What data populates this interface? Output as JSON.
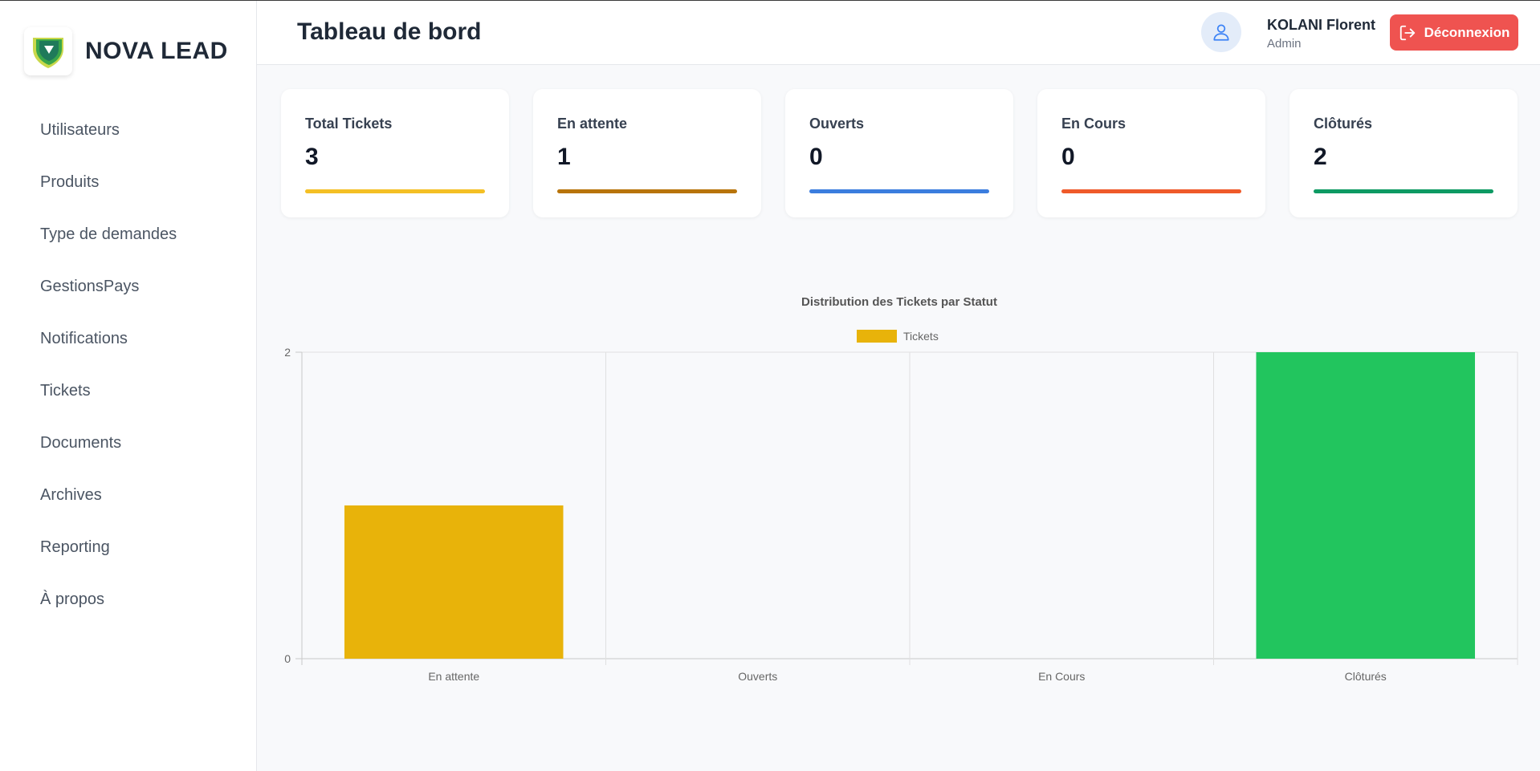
{
  "brand": {
    "name": "NOVA LEAD"
  },
  "sidebar": {
    "items": [
      {
        "label": "Utilisateurs"
      },
      {
        "label": "Produits"
      },
      {
        "label": "Type de demandes"
      },
      {
        "label": "GestionsPays"
      },
      {
        "label": "Notifications"
      },
      {
        "label": "Tickets"
      },
      {
        "label": "Documents"
      },
      {
        "label": "Archives"
      },
      {
        "label": "Reporting"
      },
      {
        "label": "À propos"
      }
    ]
  },
  "header": {
    "title": "Tableau de bord",
    "user": {
      "name": "KOLANI Florent",
      "role": "Admin",
      "icon": "user-icon"
    },
    "logout_label": "Déconnexion",
    "logout_icon": "logout-icon",
    "logout_color": "#ef5350"
  },
  "stats": [
    {
      "label": "Total Tickets",
      "value": "3",
      "color": "#f4c025"
    },
    {
      "label": "En attente",
      "value": "1",
      "color": "#b8740a"
    },
    {
      "label": "Ouverts",
      "value": "0",
      "color": "#3b7dde"
    },
    {
      "label": "En Cours",
      "value": "0",
      "color": "#ef5a2a"
    },
    {
      "label": "Clôturés",
      "value": "2",
      "color": "#0e9a63"
    }
  ],
  "chart_data": {
    "type": "bar",
    "title": "Distribution des Tickets par Statut",
    "categories": [
      "En attente",
      "Ouverts",
      "En Cours",
      "Clôturés"
    ],
    "series": [
      {
        "name": "Tickets",
        "values": [
          1,
          0,
          0,
          2
        ]
      }
    ],
    "bar_colors": [
      "#e8b30a",
      "#3b7dde",
      "#ef5a2a",
      "#22c55e"
    ],
    "legend_color": "#e8b30a",
    "ylim": [
      0,
      2
    ],
    "yticks": [
      "0",
      "2"
    ],
    "grid": true,
    "legend": "top-center"
  }
}
